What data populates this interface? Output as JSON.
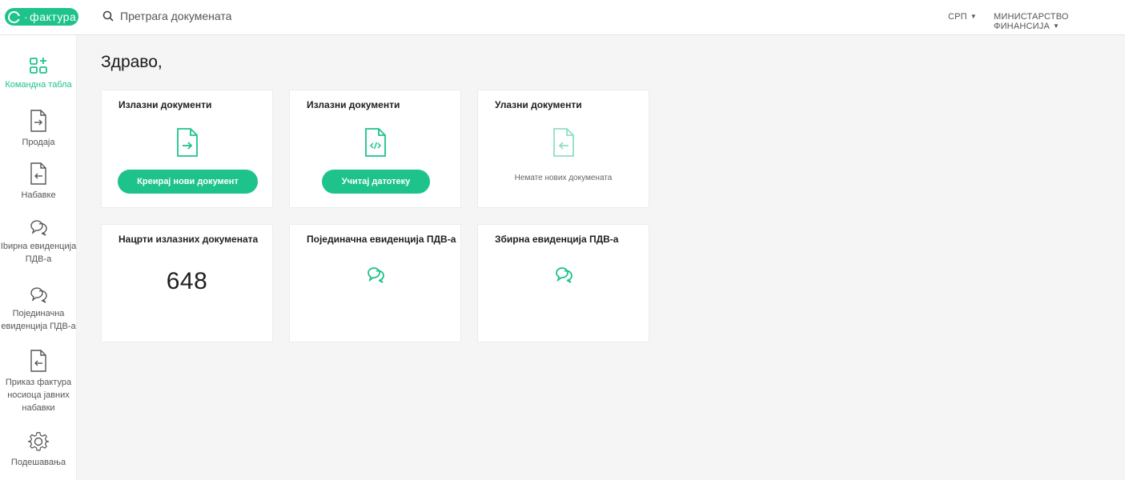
{
  "header": {
    "logo_text": "фактура",
    "search_placeholder": "Претрага докумената",
    "language": "СРП",
    "organization": "МИНИСТАРСТВО ФИНАНСИЈА"
  },
  "sidebar": {
    "items": [
      {
        "label": "Командна табла",
        "icon": "dashboard-icon",
        "active": true
      },
      {
        "label": "Продаја",
        "icon": "document-arrow-right-icon"
      },
      {
        "label": "Набавке",
        "icon": "document-arrow-left-icon"
      },
      {
        "label": "Ibирна евиденција ПДВ-а",
        "icon": "chat-bubbles-icon"
      },
      {
        "label": "Појединачна евиденција ПДВ-а",
        "icon": "chat-bubbles-icon"
      },
      {
        "label": "Приказ фактура носиоца јавних набавки",
        "icon": "document-arrow-left-icon"
      },
      {
        "label": "Подешавања",
        "icon": "gear-icon"
      }
    ]
  },
  "main": {
    "greeting": "Здраво,",
    "cards": [
      {
        "title": "Излазни документи",
        "button": "Креирај нови документ",
        "icon": "document-arrow-right-icon"
      },
      {
        "title": "Излазни документи",
        "button": "Учитај датотеку",
        "icon": "document-code-icon"
      },
      {
        "title": "Улазни документи",
        "note": "Немате нових докумената",
        "icon": "document-arrow-left-icon"
      },
      {
        "title": "Нацрти излазних докумената",
        "value": "648"
      },
      {
        "title": "Појединачна евиденција ПДВ-а",
        "icon": "chat-bubbles-icon"
      },
      {
        "title": "Збирна евиденција ПДВ-а",
        "icon": "chat-bubbles-icon"
      }
    ]
  },
  "colors": {
    "accent": "#1ec38b",
    "background": "#f5f5f5"
  }
}
